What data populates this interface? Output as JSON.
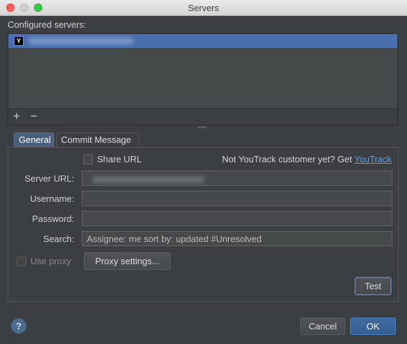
{
  "window": {
    "title": "Servers"
  },
  "servers": {
    "label": "Configured servers:",
    "items": [
      {
        "icon": "youtrack-icon",
        "name": ""
      }
    ],
    "toolbar": {
      "add": "+",
      "remove": "−"
    }
  },
  "tabs": [
    {
      "label": "General",
      "active": true
    },
    {
      "label": "Commit Message",
      "active": false
    }
  ],
  "general": {
    "share_url_label": "Share URL",
    "share_url_checked": false,
    "not_customer_text": "Not YouTrack customer yet? Get ",
    "youtrack_link": "YouTrack",
    "fields": {
      "server_url": {
        "label": "Server URL:",
        "value": ""
      },
      "username": {
        "label": "Username:",
        "value": ""
      },
      "password": {
        "label": "Password:",
        "value": ""
      },
      "search": {
        "label": "Search:",
        "value": "Assignee: me sort by: updated #Unresolved"
      }
    },
    "use_proxy_label": "Use proxy",
    "use_proxy_checked": false,
    "proxy_settings_label": "Proxy settings...",
    "test_label": "Test"
  },
  "footer": {
    "help": "?",
    "cancel": "Cancel",
    "ok": "OK"
  },
  "colors": {
    "accent": "#4b6eaf",
    "ok_button": "#365f94",
    "link": "#589df6",
    "background": "#3c3f41"
  }
}
